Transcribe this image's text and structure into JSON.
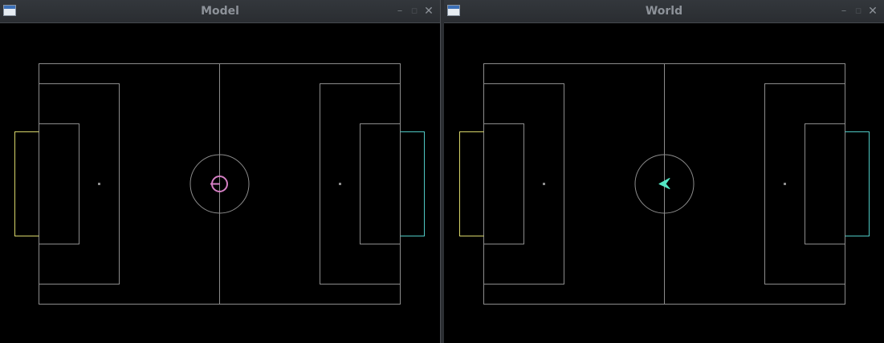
{
  "windows": {
    "model": {
      "title": "Model",
      "marker": "ball-with-heading",
      "marker_color": "#d57fc4"
    },
    "world": {
      "title": "World",
      "marker": "player-arrow",
      "marker_color": "#54e6c4"
    }
  },
  "controls": {
    "minimize_symbol": "–",
    "maximize_symbol": "▫",
    "close_symbol": "✕"
  },
  "colors": {
    "field_lines": "#8c8c8c",
    "left_goal": "#d8d66a",
    "right_goal": "#4fc9c4",
    "background": "#000000"
  }
}
